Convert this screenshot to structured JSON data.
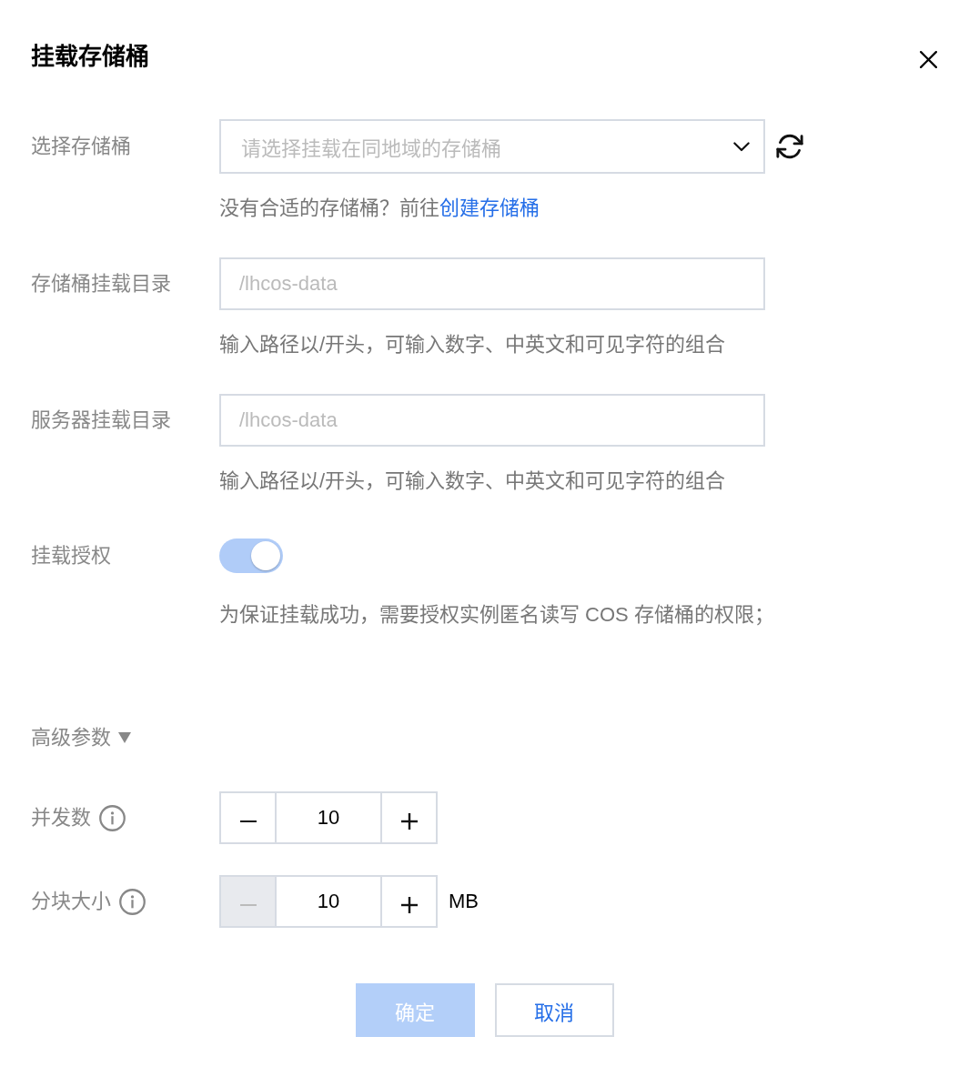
{
  "dialog": {
    "title": "挂载存储桶"
  },
  "fields": [
    {
      "kind": "select",
      "label": "选择存储桶",
      "placeholder": "请选择挂载在同地域的存储桶",
      "hint": "没有合适的存储桶？前往",
      "hint_link": "创建存储桶"
    },
    {
      "kind": "input",
      "label": "存储桶挂载目录",
      "placeholder": "/lhcos-data",
      "hint": "输入路径以/开头，可输入数字、中英文和可见字符的组合"
    },
    {
      "kind": "input",
      "label": "服务器挂载目录",
      "placeholder": "/lhcos-data",
      "hint": "输入路径以/开头，可输入数字、中英文和可见字符的组合"
    },
    {
      "kind": "switch",
      "label": "挂载授权",
      "on": true,
      "disabled": true,
      "hint": "为保证挂载成功，需要授权实例匿名读写 COS 存储桶的权限；"
    }
  ],
  "advanced": {
    "label": "高级参数",
    "expanded": true
  },
  "steppers": [
    {
      "label": "并发数",
      "value": "10",
      "decrement_disabled": false
    },
    {
      "label": "分块大小",
      "value": "10",
      "decrement_disabled": true,
      "unit": "MB"
    }
  ],
  "buttons": [
    {
      "label": "确定",
      "kind": "primary",
      "disabled": true
    },
    {
      "label": "取消",
      "kind": "secondary",
      "disabled": false
    }
  ]
}
